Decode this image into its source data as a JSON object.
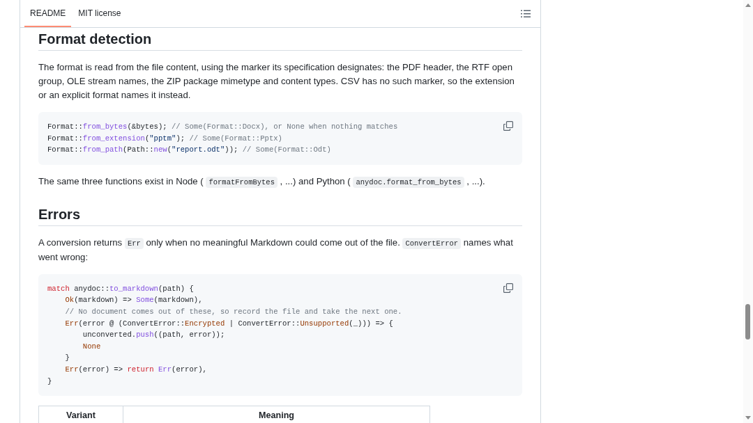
{
  "tabs": [
    {
      "label": "README",
      "selected": true
    },
    {
      "label": "MIT license",
      "selected": false
    }
  ],
  "content": [
    {
      "kind": "heading",
      "text": "Format detection"
    },
    {
      "kind": "paragraph",
      "parts": [
        {
          "kind": "text",
          "text": "The format is read from the file content, using the marker its specification designates: the PDF header, the RTF open group, OLE stream names, the ZIP package mimetype and content types. CSV has no such marker, so the extension or an explicit format names it instead."
        }
      ]
    },
    {
      "kind": "code",
      "lines": [
        [
          {
            "kind": "plain",
            "text": "Format::"
          },
          {
            "kind": "fn",
            "text": "from_bytes"
          },
          {
            "kind": "plain",
            "text": "(&bytes); "
          },
          {
            "kind": "comment",
            "text": "// Some(Format::Docx), or None when nothing matches"
          }
        ],
        [
          {
            "kind": "plain",
            "text": "Format::"
          },
          {
            "kind": "fn",
            "text": "from_extension"
          },
          {
            "kind": "plain",
            "text": "("
          },
          {
            "kind": "str",
            "text": "\"pptm\""
          },
          {
            "kind": "plain",
            "text": "); "
          },
          {
            "kind": "comment",
            "text": "// Some(Format::Pptx)"
          }
        ],
        [
          {
            "kind": "plain",
            "text": "Format::"
          },
          {
            "kind": "fn",
            "text": "from_path"
          },
          {
            "kind": "plain",
            "text": "(Path::"
          },
          {
            "kind": "fn",
            "text": "new"
          },
          {
            "kind": "plain",
            "text": "("
          },
          {
            "kind": "str",
            "text": "\"report.odt\""
          },
          {
            "kind": "plain",
            "text": ")); "
          },
          {
            "kind": "comment",
            "text": "// Some(Format::Odt)"
          }
        ]
      ]
    },
    {
      "kind": "paragraph",
      "parts": [
        {
          "kind": "text",
          "text": "The same three functions exist in Node ( "
        },
        {
          "kind": "code",
          "text": "formatFromBytes"
        },
        {
          "kind": "text",
          "text": " , ...) and Python ( "
        },
        {
          "kind": "code",
          "text": "anydoc.format_from_bytes"
        },
        {
          "kind": "text",
          "text": " , ...)."
        }
      ]
    },
    {
      "kind": "heading",
      "text": "Errors"
    },
    {
      "kind": "paragraph",
      "parts": [
        {
          "kind": "text",
          "text": "A conversion returns "
        },
        {
          "kind": "code",
          "text": "Err"
        },
        {
          "kind": "text",
          "text": " only when no meaningful Markdown could come out of the file. "
        },
        {
          "kind": "code",
          "text": "ConvertError"
        },
        {
          "kind": "text",
          "text": " names what went wrong:"
        }
      ]
    },
    {
      "kind": "code",
      "lines": [
        [
          {
            "kind": "kw",
            "text": "match"
          },
          {
            "kind": "plain",
            "text": " anydoc::"
          },
          {
            "kind": "fn",
            "text": "to_markdown"
          },
          {
            "kind": "plain",
            "text": "(path) {"
          }
        ],
        [
          {
            "kind": "variant",
            "text": "    Ok"
          },
          {
            "kind": "plain",
            "text": "(markdown) => "
          },
          {
            "kind": "fn",
            "text": "Some"
          },
          {
            "kind": "plain",
            "text": "(markdown),"
          }
        ],
        [
          {
            "kind": "comment",
            "text": "    // No document comes out of these, so record the file and take the next one."
          }
        ],
        [
          {
            "kind": "variant",
            "text": "    Err"
          },
          {
            "kind": "plain",
            "text": "(error @ (ConvertError::"
          },
          {
            "kind": "variant",
            "text": "Encrypted"
          },
          {
            "kind": "plain",
            "text": " | ConvertError::"
          },
          {
            "kind": "variant",
            "text": "Unsupported"
          },
          {
            "kind": "plain",
            "text": "(_))) => {"
          }
        ],
        [
          {
            "kind": "plain",
            "text": "        unconverted."
          },
          {
            "kind": "fn",
            "text": "push"
          },
          {
            "kind": "plain",
            "text": "((path, error));"
          }
        ],
        [
          {
            "kind": "variant",
            "text": "        None"
          }
        ],
        [
          {
            "kind": "plain",
            "text": "    }"
          }
        ],
        [
          {
            "kind": "variant",
            "text": "    Err"
          },
          {
            "kind": "plain",
            "text": "(error) => "
          },
          {
            "kind": "kw",
            "text": "return "
          },
          {
            "kind": "fn",
            "text": "Err"
          },
          {
            "kind": "plain",
            "text": "(error),"
          }
        ],
        [
          {
            "kind": "plain",
            "text": "}"
          }
        ]
      ]
    },
    {
      "kind": "table",
      "columns": [
        "Variant",
        "Meaning"
      ]
    }
  ]
}
